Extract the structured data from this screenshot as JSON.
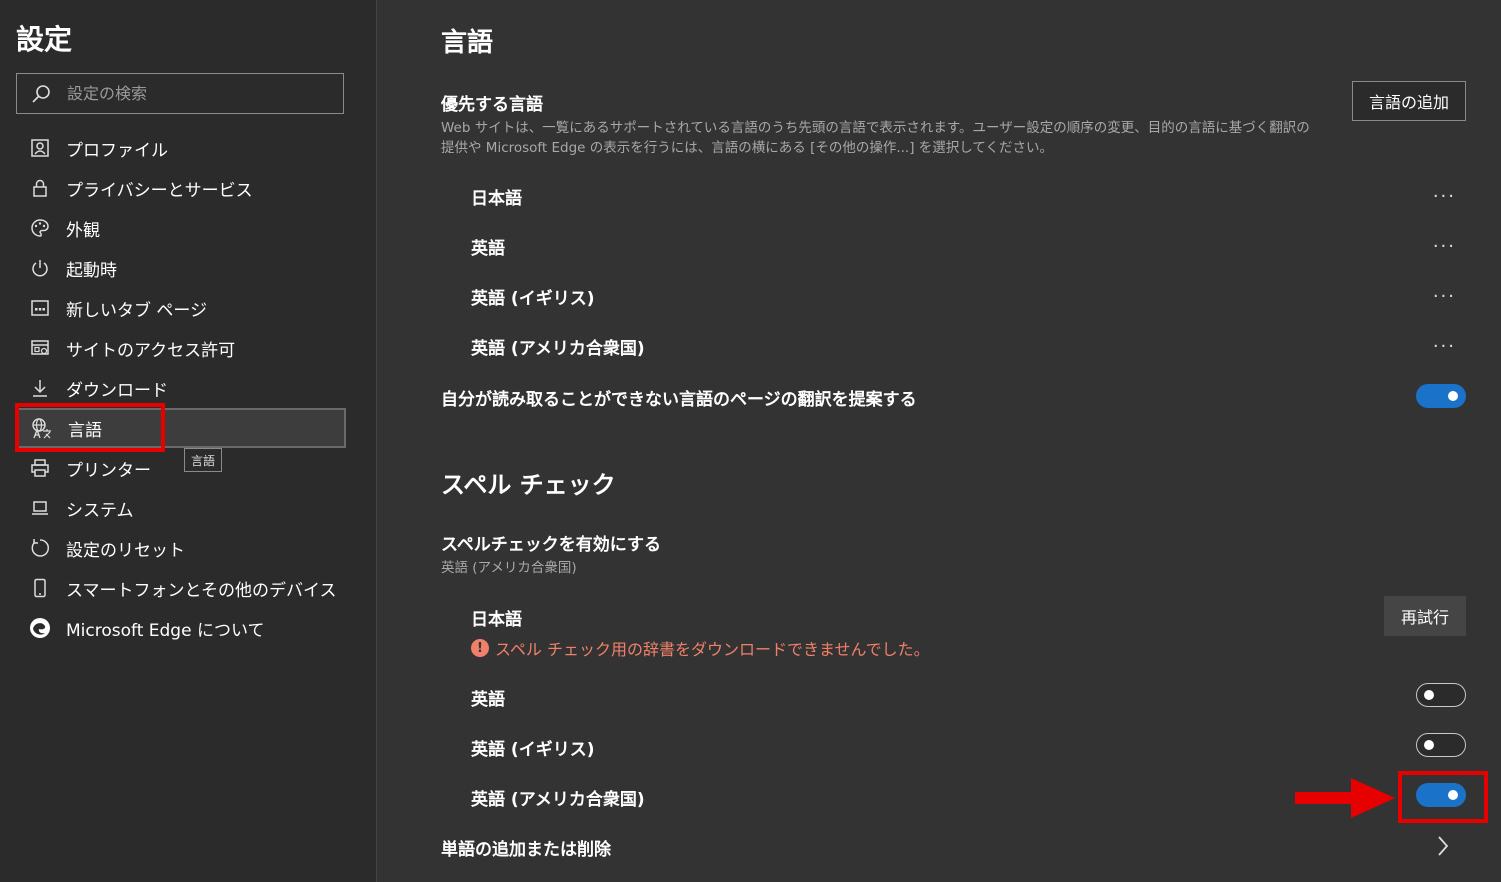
{
  "sidebar": {
    "title": "設定",
    "search_placeholder": "設定の検索",
    "items": [
      {
        "label": "プロファイル",
        "icon": "profile-icon"
      },
      {
        "label": "プライバシーとサービス",
        "icon": "lock-icon"
      },
      {
        "label": "外観",
        "icon": "palette-icon"
      },
      {
        "label": "起動時",
        "icon": "power-icon"
      },
      {
        "label": "新しいタブ ページ",
        "icon": "new-tab-icon"
      },
      {
        "label": "サイトのアクセス許可",
        "icon": "site-permissions-icon"
      },
      {
        "label": "ダウンロード",
        "icon": "download-icon"
      },
      {
        "label": "言語",
        "icon": "language-icon",
        "active": true
      },
      {
        "label": "プリンター",
        "icon": "printer-icon"
      },
      {
        "label": "システム",
        "icon": "system-icon"
      },
      {
        "label": "設定のリセット",
        "icon": "reset-icon"
      },
      {
        "label": "スマートフォンとその他のデバイス",
        "icon": "phone-icon"
      },
      {
        "label": "Microsoft Edge について",
        "icon": "edge-logo-icon"
      }
    ],
    "tooltip": "言語"
  },
  "main": {
    "title": "言語",
    "preferred": {
      "title": "優先する言語",
      "description": "Web サイトは、一覧にあるサポートされている言語のうち先頭の言語で表示されます。ユーザー設定の順序の変更、目的の言語に基づく翻訳の提供や Microsoft Edge の表示を行うには、言語の横にある [その他の操作...] を選択してください。",
      "add_button": "言語の追加",
      "languages": [
        "日本語",
        "英語",
        "英語 (イギリス)",
        "英語 (アメリカ合衆国)"
      ],
      "more_label": "···"
    },
    "translate": {
      "label": "自分が読み取ることができない言語のページの翻訳を提案する",
      "on": true
    },
    "spell": {
      "title": "スペル チェック",
      "enable_label": "スペルチェックを有効にする",
      "enable_sub": "英語 (アメリカ合衆国)",
      "japanese": {
        "name": "日本語",
        "retry_button": "再試行",
        "error": "スペル チェック用の辞書をダウンロードできませんでした。"
      },
      "languages": [
        {
          "name": "英語",
          "on": false
        },
        {
          "name": "英語 (イギリス)",
          "on": false
        },
        {
          "name": "英語 (アメリカ合衆国)",
          "on": true
        }
      ],
      "words_label": "単語の追加または削除"
    }
  },
  "colors": {
    "accent": "#1a73c9",
    "highlight": "#e60000",
    "error": "#f0806a"
  }
}
